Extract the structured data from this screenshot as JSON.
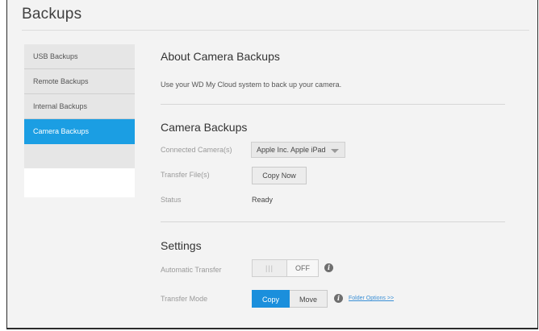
{
  "page": {
    "title": "Backups"
  },
  "sidebar": {
    "items": [
      {
        "label": "USB Backups",
        "active": false
      },
      {
        "label": "Remote Backups",
        "active": false
      },
      {
        "label": "Internal Backups",
        "active": false
      },
      {
        "label": "Camera Backups",
        "active": true
      }
    ]
  },
  "about": {
    "title": "About Camera Backups",
    "description": "Use your WD My Cloud system to back up your camera."
  },
  "camera_backups": {
    "title": "Camera Backups",
    "connected_label": "Connected Camera(s)",
    "connected_value": "Apple Inc. Apple iPad",
    "transfer_label": "Transfer File(s)",
    "copy_now_label": "Copy Now",
    "status_label": "Status",
    "status_value": "Ready"
  },
  "settings": {
    "title": "Settings",
    "auto_transfer_label": "Automatic Transfer",
    "auto_transfer_grip": "|||",
    "auto_transfer_state": "OFF",
    "transfer_mode_label": "Transfer Mode",
    "mode_copy": "Copy",
    "mode_move": "Move",
    "selected_mode": "Copy",
    "folder_options_link": "Folder Options >>",
    "info_glyph": "i"
  },
  "colors": {
    "accent": "#1b9ee3",
    "background": "#f3f3f3"
  }
}
